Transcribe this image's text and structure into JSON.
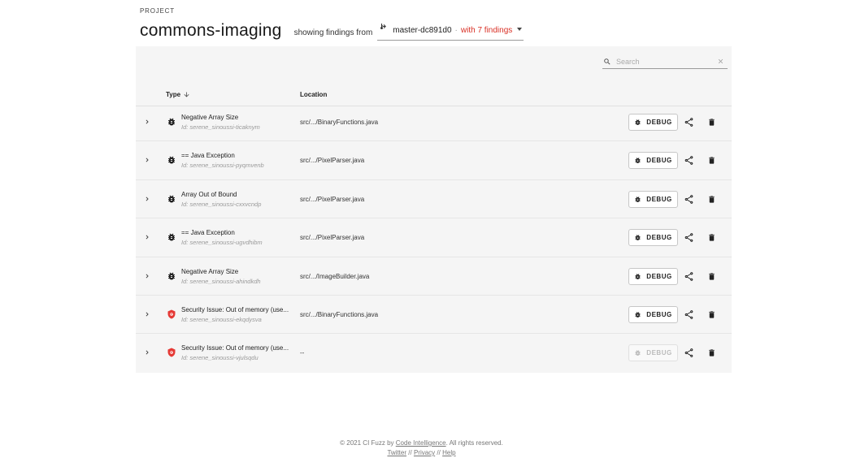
{
  "header": {
    "eyebrow": "PROJECT",
    "title": "commons-imaging",
    "showing_label": "showing findings from",
    "branch": "master-dc891d0",
    "separator": "·",
    "findings_count": "with 7 findings"
  },
  "search": {
    "placeholder": "Search",
    "value": ""
  },
  "table": {
    "col_type": "Type",
    "col_location": "Location",
    "debug_label": "DEBUG",
    "rows": [
      {
        "title": "Negative Array Size",
        "id": "Id: serene_sinoussi-ticaknym",
        "location": "src/.../BinaryFunctions.java",
        "icon": "bug-icon",
        "debug_enabled": true
      },
      {
        "title": "== Java Exception",
        "id": "Id: serene_sinoussi-pyqmvenb",
        "location": "src/.../PixelParser.java",
        "icon": "bug-icon",
        "debug_enabled": true
      },
      {
        "title": "Array Out of Bound",
        "id": "Id: serene_sinoussi-cxxvcndp",
        "location": "src/.../PixelParser.java",
        "icon": "bug-icon",
        "debug_enabled": true
      },
      {
        "title": "== Java Exception",
        "id": "Id: serene_sinoussi-ugvdhibm",
        "location": "src/.../PixelParser.java",
        "icon": "bug-icon",
        "debug_enabled": true
      },
      {
        "title": "Negative Array Size",
        "id": "Id: serene_sinoussi-ahindkdh",
        "location": "src/.../ImageBuilder.java",
        "icon": "bug-icon",
        "debug_enabled": true
      },
      {
        "title": "Security Issue: Out of memory (use...",
        "id": "Id: serene_sinoussi-ekqdysva",
        "location": "src/.../BinaryFunctions.java",
        "icon": "shield-icon",
        "debug_enabled": true
      },
      {
        "title": "Security Issue: Out of memory (use...",
        "id": "Id: serene_sinoussi-vjulsqdu",
        "location": "--",
        "icon": "shield-icon",
        "debug_enabled": false
      }
    ]
  },
  "footer": {
    "copyright": "© 2021 CI Fuzz by",
    "company": "Code Intelligence",
    "rights": ". All rights reserved.",
    "twitter": "Twitter",
    "privacy": "Privacy",
    "help": "Help",
    "divider": "//"
  },
  "colors": {
    "accent_red": "#d93025",
    "panel_bg": "#f5f5f5",
    "icon_dark": "#222222"
  }
}
